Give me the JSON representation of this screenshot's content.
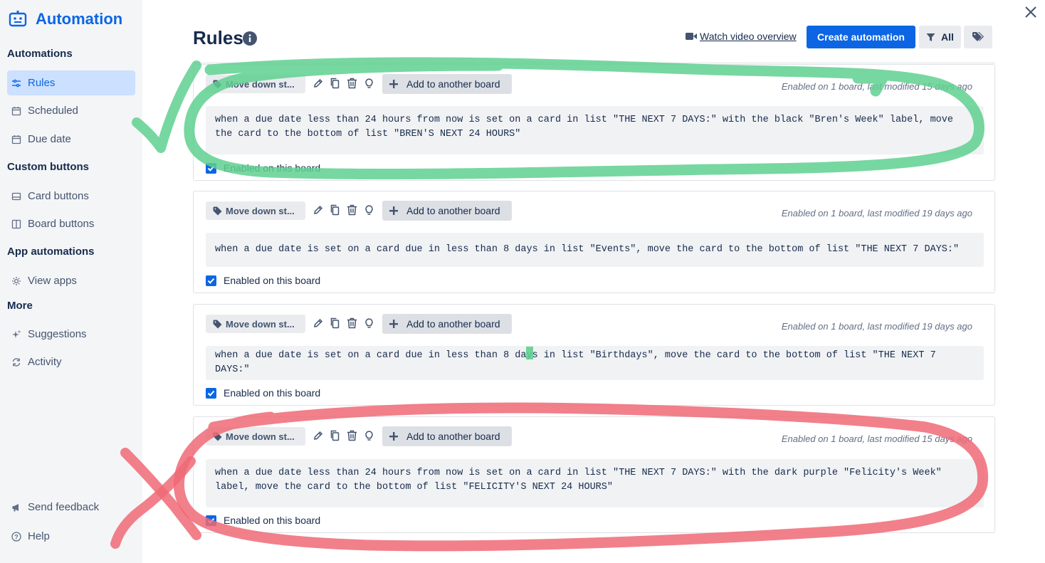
{
  "sidebar": {
    "brand": "Automation",
    "sections": {
      "automations": "Automations",
      "custom_buttons": "Custom buttons",
      "app_automations": "App automations",
      "more": "More"
    },
    "items": {
      "rules": "Rules",
      "scheduled": "Scheduled",
      "due_date": "Due date",
      "card_buttons": "Card buttons",
      "board_buttons": "Board buttons",
      "view_apps": "View apps",
      "suggestions": "Suggestions",
      "activity": "Activity",
      "send_feedback": "Send feedback",
      "help": "Help"
    },
    "active_item": "rules"
  },
  "header": {
    "title": "Rules",
    "watch_label": "Watch video overview",
    "create_label": "Create automation",
    "filter_label": "All"
  },
  "colors": {
    "accent": "#0c66e4",
    "green_annotation": "#5fd08f",
    "red_annotation": "#ee6a76"
  },
  "rules": [
    {
      "tag": "Move down st...",
      "add_label": "Add to another board",
      "meta": "Enabled on 1 board, last modified 15 days ago",
      "description": "when a due date less than 24 hours from now is set on a card in list \"THE NEXT 7 DAYS:\" with the black \"Bren's Week\" label, move the card to the bottom of list \"BREN'S NEXT 24 HOURS\"",
      "enabled_label": "Enabled on this board",
      "enabled": true
    },
    {
      "tag": "Move down st...",
      "add_label": "Add to another board",
      "meta": "Enabled on 1 board, last modified 19 days ago",
      "description": "when a due date is set on a card due in less than 8 days in list \"Events\", move the card to the bottom of list \"THE NEXT 7 DAYS:\"",
      "enabled_label": "Enabled on this board",
      "enabled": true
    },
    {
      "tag": "Move down st...",
      "add_label": "Add to another board",
      "meta": "Enabled on 1 board, last modified 19 days ago",
      "description": "when a due date is set on a card due in less than 8 days in list \"Birthdays\", move the card to the bottom of list \"THE NEXT 7 DAYS:\"",
      "enabled_label": "Enabled on this board",
      "enabled": true
    },
    {
      "tag": "Move down st...",
      "add_label": "Add to another board",
      "meta": "Enabled on 1 board, last modified 15 days ago",
      "description": "when a due date less than 24 hours from now is set on a card in list \"THE NEXT 7 DAYS:\" with the dark purple \"Felicity's Week\" label, move the card to the bottom of list \"FELICITY'S NEXT 24 HOURS\"",
      "enabled_label": "Enabled on this board",
      "enabled": true
    }
  ]
}
